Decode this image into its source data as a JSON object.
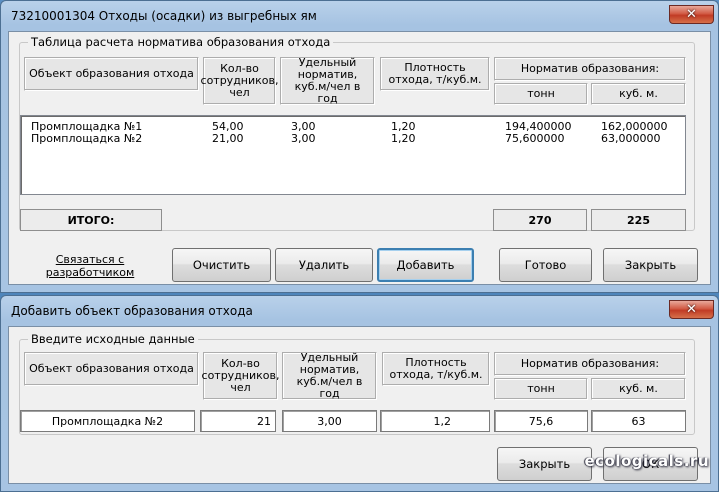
{
  "main_window": {
    "title": "73210001304 Отходы (осадки) из выгребных ям",
    "close_glyph": "✕",
    "group_title": "Таблица расчета норматива образования отхода",
    "headers": {
      "object": "Объект образования отхода",
      "employees": "Кол-во сотрудников, чел",
      "norm": "Удельный норматив, куб.м/чел в год",
      "density": "Плотность отхода, т/куб.м.",
      "formation": "Норматив образования:",
      "tons": "тонн",
      "cubic": "куб. м."
    },
    "rows": [
      {
        "object": "Промплощадка №1",
        "employees": "54,00",
        "norm": "3,00",
        "density": "1,20",
        "tons": "194,400000",
        "cubic": "162,000000"
      },
      {
        "object": "Промплощадка №2",
        "employees": "21,00",
        "norm": "3,00",
        "density": "1,20",
        "tons": "75,600000",
        "cubic": "63,000000"
      }
    ],
    "total_label": "ИТОГО:",
    "total_tons": "270",
    "total_cubic": "225",
    "contact_link": "Связаться с разработчиком",
    "buttons": {
      "clear": "Очистить",
      "delete": "Удалить",
      "add": "Добавить",
      "done": "Готово",
      "close": "Закрыть"
    }
  },
  "add_window": {
    "title": "Добавить объект образования отхода",
    "close_glyph": "✕",
    "group_title": "Введите исходные данные",
    "headers": {
      "object": "Объект образования отхода",
      "employees": "Кол-во сотрудников, чел",
      "norm": "Удельный норматив, куб.м/чел в год",
      "density": "Плотность отхода, т/куб.м.",
      "formation": "Норматив образования:",
      "tons": "тонн",
      "cubic": "куб. м."
    },
    "fields": {
      "object": "Промплощадка №2",
      "employees": "21",
      "norm": "3,00",
      "density": "1,2",
      "tons": "75,6",
      "cubic": "63"
    },
    "buttons": {
      "close": "Закрыть",
      "ok": "ОК"
    }
  },
  "watermark": "ecologicals.ru",
  "colors": {
    "window_frame": "#a7c4e3",
    "client_bg": "#f0f0f0",
    "close_button": "#c13b25",
    "default_button_border": "#3c7fb1"
  }
}
